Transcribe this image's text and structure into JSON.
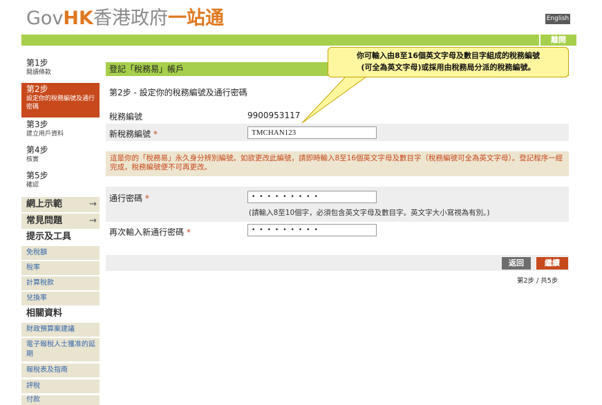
{
  "header": {
    "logo_gov": "Gov",
    "logo_hk": "HK",
    "logo_zh": "香港政府",
    "logo_zh2": "一站通",
    "english_label": "English",
    "logout_label": "離開"
  },
  "sidebar": {
    "steps": [
      {
        "title": "第1步",
        "sub": "閱讀條款"
      },
      {
        "title": "第2步",
        "sub": "設定你的稅務編號及通行密碼",
        "active": true
      },
      {
        "title": "第3步",
        "sub": "建立用戶資料"
      },
      {
        "title": "第4步",
        "sub": "核實"
      },
      {
        "title": "第5步",
        "sub": "確認"
      }
    ],
    "menus": [
      {
        "label": "網上示範",
        "arrow": "→"
      },
      {
        "label": "常見問題",
        "arrow": "→"
      }
    ],
    "tools_heading": "提示及工具",
    "tools": [
      "免稅額",
      "稅率",
      "計算稅款",
      "兌換率"
    ],
    "related_heading": "相關資料",
    "related": [
      "財政預算案建議",
      "電子報稅人士獲准的延期",
      "報稅表及指南",
      "評稅",
      "付款"
    ]
  },
  "form": {
    "header": "登記「稅務易」帳戶",
    "step_title": "第2步  -  設定你的稅務編號及通行密碼",
    "tax_file_label": "稅務編號",
    "tax_file_value": "9900953117",
    "new_tax_file_label": "新稅務編號",
    "new_tax_file_value": "TMCHAN123",
    "required_mark": "*",
    "notice": "這是你的「稅務易」永久身分辨別編號。如欲更改此編號，請即時輸入8至16個英文字母及數目字（稅務編號可全為英文字母）。登記程序一經完成，稅務編號便不可再更改。",
    "password_label": "通行密碼",
    "password_mask": "•••••••••",
    "password_hint": "(請輸入8至10個字，必須包含英文字母及數目字。英文字大小寫視為有別。)",
    "confirm_password_label": "再次輸入新通行密碼",
    "confirm_password_mask": "•••••••••",
    "back_label": "返回",
    "next_label": "繼續",
    "progress": "第2步 / 共5步"
  },
  "callout": {
    "line1": "你可輸入由8至16個英文字母及數目字組成的稅務編號",
    "line2": "(可全為英文字母)或採用由稅務局分派的稅務編號。"
  },
  "colors": {
    "accent_green": "#a6cf4b",
    "accent_orange": "#c7491c",
    "sidebar_bg": "#e9e4d0",
    "callout_bg": "#fff7a0"
  }
}
